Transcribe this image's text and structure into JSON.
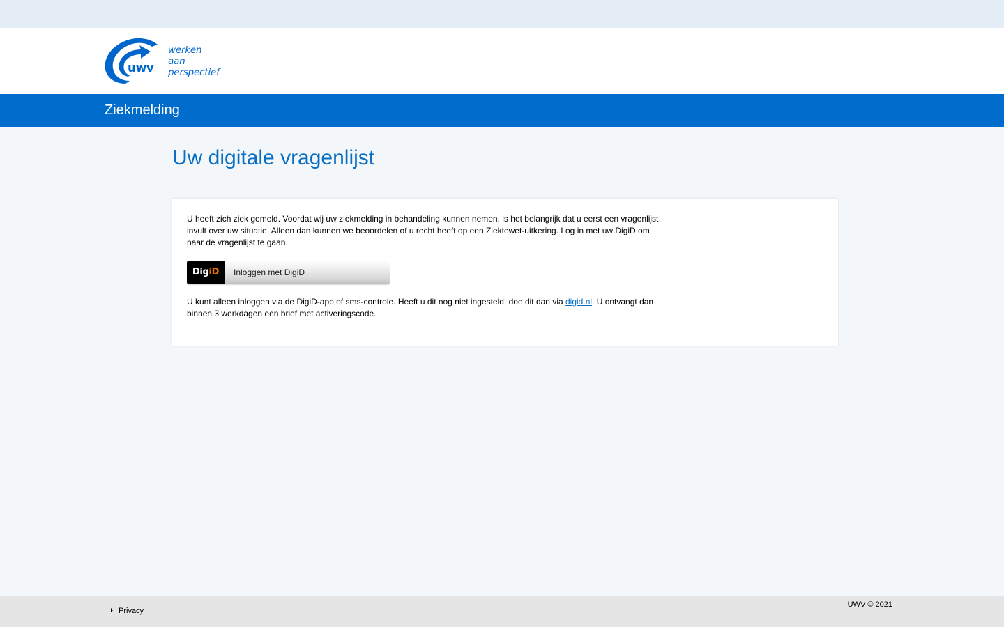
{
  "logo": {
    "word": "uwv",
    "tagline": [
      "werken",
      "aan",
      "perspectief"
    ],
    "brand_color": "#0066cc"
  },
  "header": {
    "section_title": "Ziekmelding"
  },
  "main": {
    "heading": "Uw digitale vragenlijst",
    "intro": "U heeft zich ziek gemeld. Voordat wij uw ziekmelding in behandeling kunnen nemen, is het belangrijk dat u eerst een vragenlijst invult over uw situatie. Alleen dan kunnen we beoordelen of u recht heeft op een Ziektewet-uitkering. Log in met uw DigiD om naar de vragenlijst te gaan.",
    "digid_button": {
      "logo_part1": "Dig",
      "logo_part2": "i",
      "logo_part3": "D",
      "label": "Inloggen met DigiD"
    },
    "note_before": "U kunt alleen inloggen via de DigiD-app of sms-controle. Heeft u dit nog niet ingesteld, doe dit dan via ",
    "note_link": "digid.nl",
    "note_after": ". U ontvangt dan binnen 3 werkdagen een brief met activeringscode."
  },
  "footer": {
    "privacy_label": "Privacy",
    "copyright": "UWV © 2021"
  },
  "colors": {
    "blue_bar": "#006ccb",
    "heading_blue": "#0a6fc2",
    "digid_orange": "#e17000"
  }
}
